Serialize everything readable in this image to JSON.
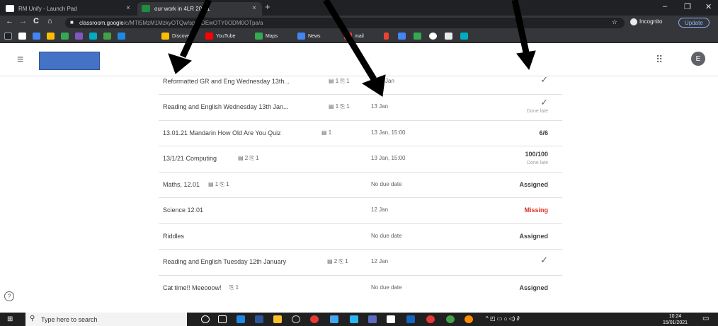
{
  "browser": {
    "tabs": [
      {
        "label": "RM Unify - Launch Pad",
        "close": "×"
      },
      {
        "label": "our work in 4LR 20-21",
        "close": "×"
      }
    ],
    "new_tab": "+",
    "window_controls": {
      "minimize": "–",
      "maximize": "❐",
      "close": "✕"
    },
    "nav": {
      "back": "←",
      "forward": "→",
      "reload": "C",
      "home": "⌂"
    },
    "url_host": "classroom.google",
    "url_rest": "/c/MTI5MzM1MzkyOTQw/sp/ODEwOTY0ODM0OTpa/a",
    "incognito_label": "Incognito",
    "update_label": "Update",
    "bookmarks": [
      {
        "label": "Discover",
        "color": "#fbbc04"
      },
      {
        "label": "YouTube",
        "color": "#ff0000"
      },
      {
        "label": "Maps",
        "color": "#34a853"
      },
      {
        "label": "News",
        "color": "#4285f4"
      },
      {
        "label": "mail",
        "color": "#ea4335"
      }
    ]
  },
  "classroom": {
    "menu_icon": "≡",
    "apps_icon": "⠿",
    "avatar_letter": "E",
    "assignments": [
      {
        "title": "Reformatted GR and Eng Wednesday 13th...",
        "meta": "▤ 1   ⎘ 1",
        "due": "Jan",
        "status": "✓",
        "sub": ""
      },
      {
        "title": "Reading and English Wednesday 13th Jan...",
        "meta": "▤ 1   ⎘ 1",
        "due": "13 Jan",
        "status": "✓",
        "sub": "Done late"
      },
      {
        "title": "13.01.21 Mandarin How Old Are You Quiz",
        "meta": "▤ 1",
        "due": "13 Jan, 15:00",
        "status": "6/6",
        "sub": ""
      },
      {
        "title": "13/1/21 Computing",
        "meta": "▤ 2   ⎘ 1",
        "due": "13 Jan, 15:00",
        "status": "100/100",
        "sub": "Done late"
      },
      {
        "title": "Maths, 12.01",
        "meta": "▤ 1   ⎘ 1",
        "due": "No due date",
        "status": "Assigned",
        "sub": ""
      },
      {
        "title": "Science 12.01",
        "meta": "",
        "due": "12 Jan",
        "status": "Missing",
        "sub": ""
      },
      {
        "title": "Riddles",
        "meta": "",
        "due": "No due date",
        "status": "Assigned",
        "sub": ""
      },
      {
        "title": "Reading and English Tuesday 12th January",
        "meta": "▤ 2   ⎘ 1",
        "due": "12 Jan",
        "status": "✓",
        "sub": ""
      },
      {
        "title": "Cat time!! Meeooow!",
        "meta": "⎘ 1",
        "due": "No due date",
        "status": "Assigned",
        "sub": ""
      }
    ],
    "help_icon": "?"
  },
  "taskbar": {
    "start": "⊞",
    "search_placeholder": "Type here to search",
    "search_icon": "⚲",
    "time": "10:24",
    "date": "15/01/2021",
    "tray": "^ ◰ ▭ ⌂ ◁) ∂"
  },
  "colors": {
    "missing": "#d93025",
    "class_banner": "#4472c4",
    "arrow": "#000000"
  }
}
